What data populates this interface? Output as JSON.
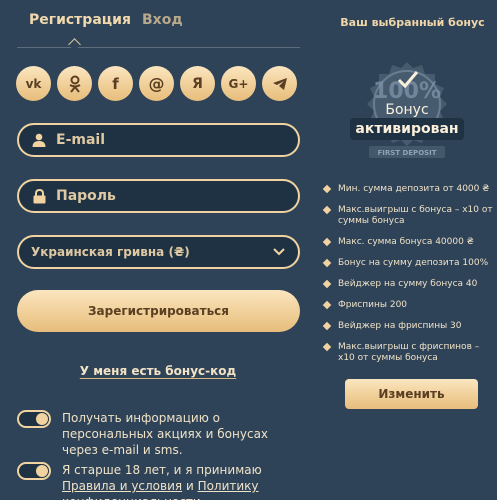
{
  "tabs": {
    "register": "Регистрация",
    "login": "Вход"
  },
  "social": [
    {
      "icon": "vk-icon",
      "glyph": "vk"
    },
    {
      "icon": "odnoklassniki-icon",
      "glyph": "ok"
    },
    {
      "icon": "facebook-icon",
      "glyph": "f"
    },
    {
      "icon": "mailru-icon",
      "glyph": "@"
    },
    {
      "icon": "yandex-icon",
      "glyph": "Я"
    },
    {
      "icon": "google-plus-icon",
      "glyph": "G+"
    },
    {
      "icon": "telegram-icon",
      "glyph": "tg"
    }
  ],
  "form": {
    "email_placeholder": "E-mail",
    "password_placeholder": "Пароль",
    "currency_selected": "Украинская гривна (₴)",
    "submit_label": "Зарегистрироваться",
    "bonus_code_link": "У меня есть бонус-код"
  },
  "consents": {
    "promo": "Получать информацию о персональных акциях и бонусах через e-mail и sms.",
    "age_prefix": "Я старше 18 лет, и я принимаю ",
    "age_rules": "Правила и условия",
    "age_and": " и ",
    "age_privacy": "Политику конфиденциальности",
    "age_suffix": "."
  },
  "bonus": {
    "title": "Ваш выбранный бонус",
    "badge_percent": "100%",
    "badge_ribbon": "FIRST DEPOSIT",
    "badge_line1": "Бонус",
    "badge_line2": "активирован",
    "perks": [
      "Мин. сумма депозита от 4000 ₴",
      "Макс.выигрыш с бонуса – x10 от суммы бонуса",
      "Макс. сумма бонуса 40000 ₴",
      "Бонус на сумму депозита 100%",
      "Вейджер на сумму бонуса 40",
      "Фриспины 200",
      "Вейджер на фриспины 30",
      "Макс.выигрыш с фриспинов – x10 от суммы бонуса"
    ],
    "change_label": "Изменить"
  },
  "colors": {
    "background": "#2f4358",
    "gold": "#f0d3a0",
    "field": "#1f3243",
    "text_dark": "#5a3f22"
  }
}
